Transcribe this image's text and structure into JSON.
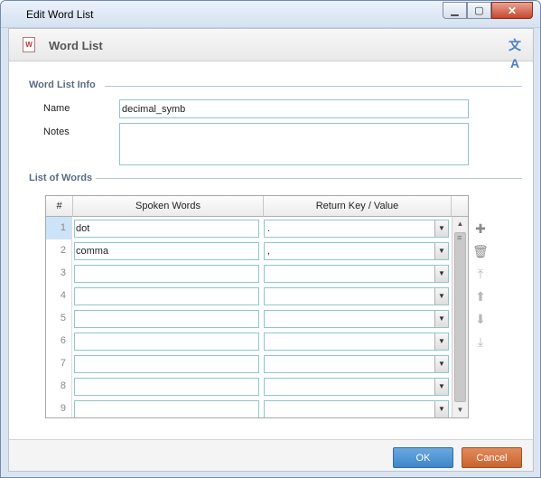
{
  "window": {
    "title": "Edit Word List"
  },
  "header": {
    "title": "Word List",
    "doc_icon": "document-icon",
    "lang_icon": "translate-icon"
  },
  "info": {
    "section_title": "Word List Info",
    "name_label": "Name",
    "name_value": "decimal_symb",
    "notes_label": "Notes",
    "notes_value": ""
  },
  "words": {
    "section_title": "List of Words",
    "columns": [
      "#",
      "Spoken Words",
      "Return Key / Value"
    ],
    "rows": [
      {
        "num": "1",
        "spoken": "dot",
        "value": "."
      },
      {
        "num": "2",
        "spoken": "comma",
        "value": ","
      },
      {
        "num": "3",
        "spoken": "",
        "value": ""
      },
      {
        "num": "4",
        "spoken": "",
        "value": ""
      },
      {
        "num": "5",
        "spoken": "",
        "value": ""
      },
      {
        "num": "6",
        "spoken": "",
        "value": ""
      },
      {
        "num": "7",
        "spoken": "",
        "value": ""
      },
      {
        "num": "8",
        "spoken": "",
        "value": ""
      },
      {
        "num": "9",
        "spoken": "",
        "value": ""
      }
    ]
  },
  "tools": [
    "add-icon",
    "delete-icon",
    "move-top-icon",
    "move-up-icon",
    "move-down-icon",
    "move-bottom-icon"
  ],
  "footer": {
    "ok_label": "OK",
    "cancel_label": "Cancel"
  }
}
